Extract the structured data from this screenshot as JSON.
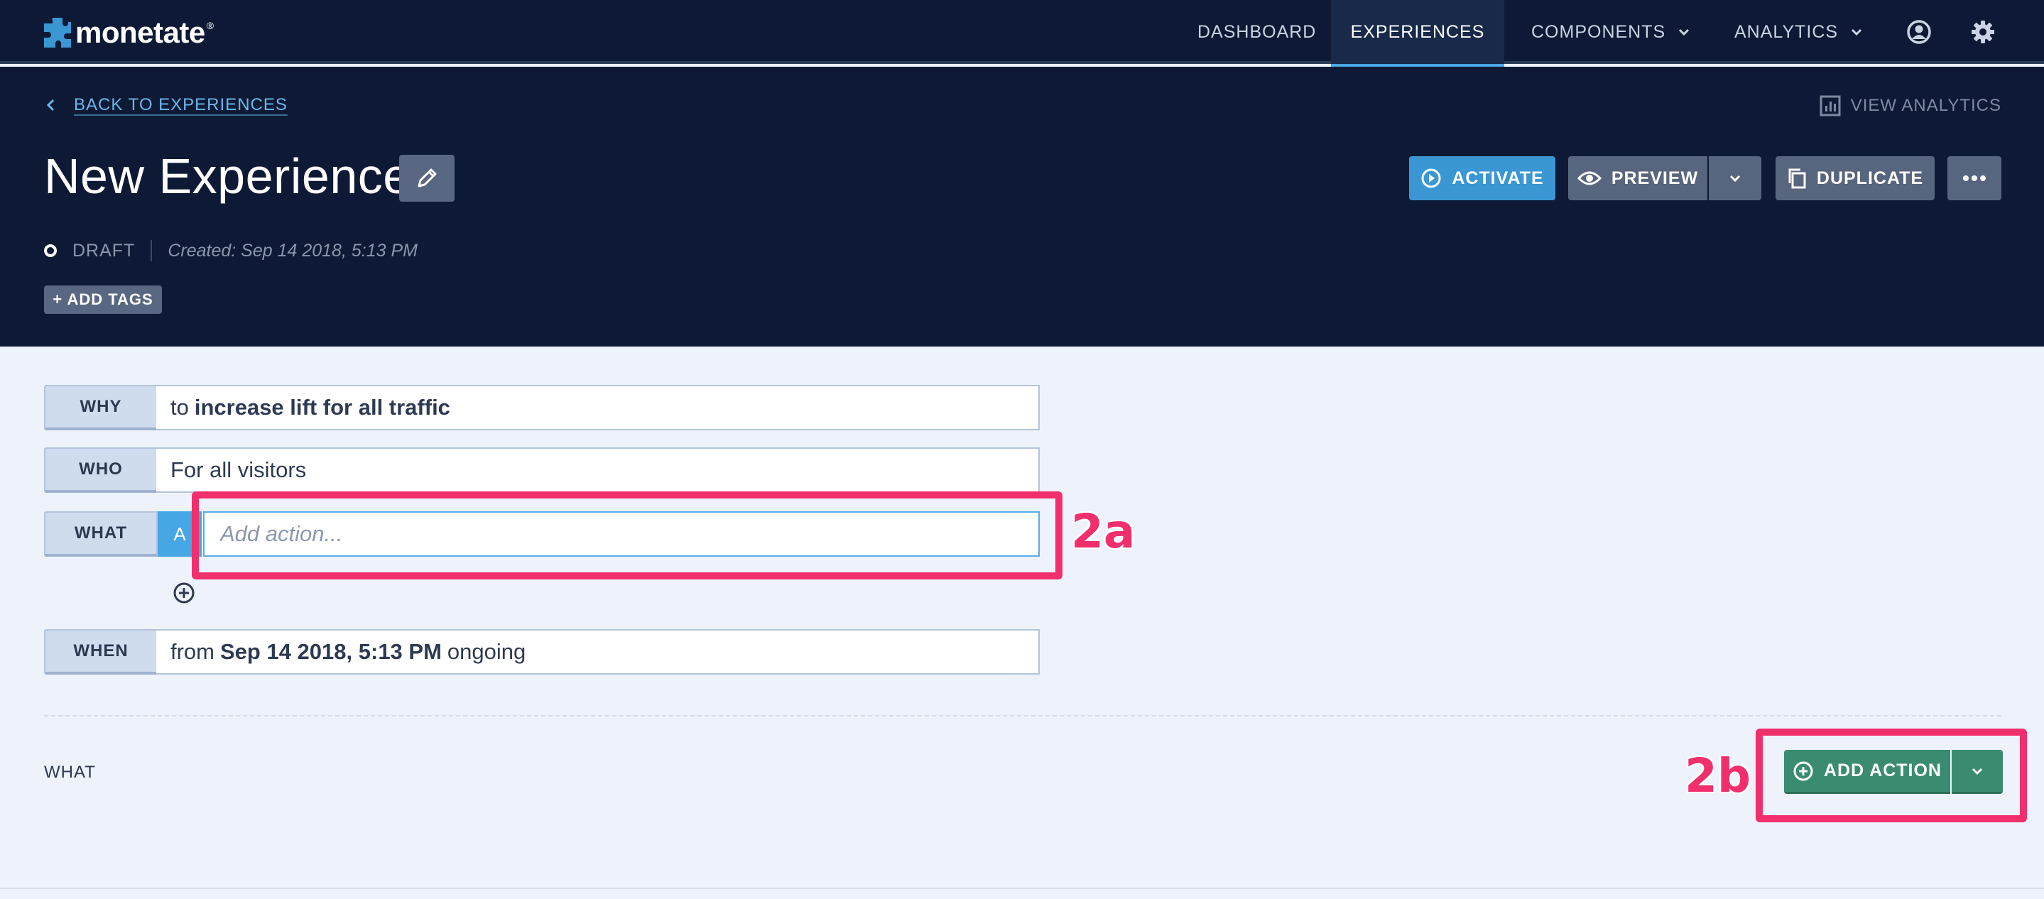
{
  "brand": {
    "name": "monetate",
    "registered": "®"
  },
  "nav": {
    "dashboard": "DASHBOARD",
    "experiences": "EXPERIENCES",
    "components": "COMPONENTS",
    "analytics": "ANALYTICS",
    "icons": [
      "user-circle-icon",
      "gear-icon"
    ]
  },
  "header": {
    "back_link": "BACK TO EXPERIENCES",
    "view_analytics": "VIEW ANALYTICS",
    "title": "New Experience",
    "buttons": {
      "activate": "ACTIVATE",
      "preview": "PREVIEW",
      "duplicate": "DUPLICATE"
    },
    "status": "DRAFT",
    "created": "Created: Sep 14 2018, 5:13 PM",
    "add_tags": "+ ADD TAGS"
  },
  "summary": {
    "why": {
      "label": "WHY",
      "prefix": "to",
      "value": "increase lift for all traffic"
    },
    "who": {
      "label": "WHO",
      "value": "For all visitors"
    },
    "what": {
      "label": "WHAT",
      "badge": "A",
      "placeholder": "Add action..."
    },
    "when": {
      "label": "WHEN",
      "prefix": "from",
      "date": "Sep 14 2018, 5:13 PM",
      "suffix": "ongoing"
    }
  },
  "annotations": {
    "a": "2a",
    "b": "2b"
  },
  "colors": {
    "highlight": "#f02f6c",
    "nav_bg": "#0e1a35",
    "accent": "#3a97d4",
    "add_action": "#3a8c70"
  },
  "what_section": {
    "label": "WHAT",
    "add_action": "ADD ACTION"
  }
}
